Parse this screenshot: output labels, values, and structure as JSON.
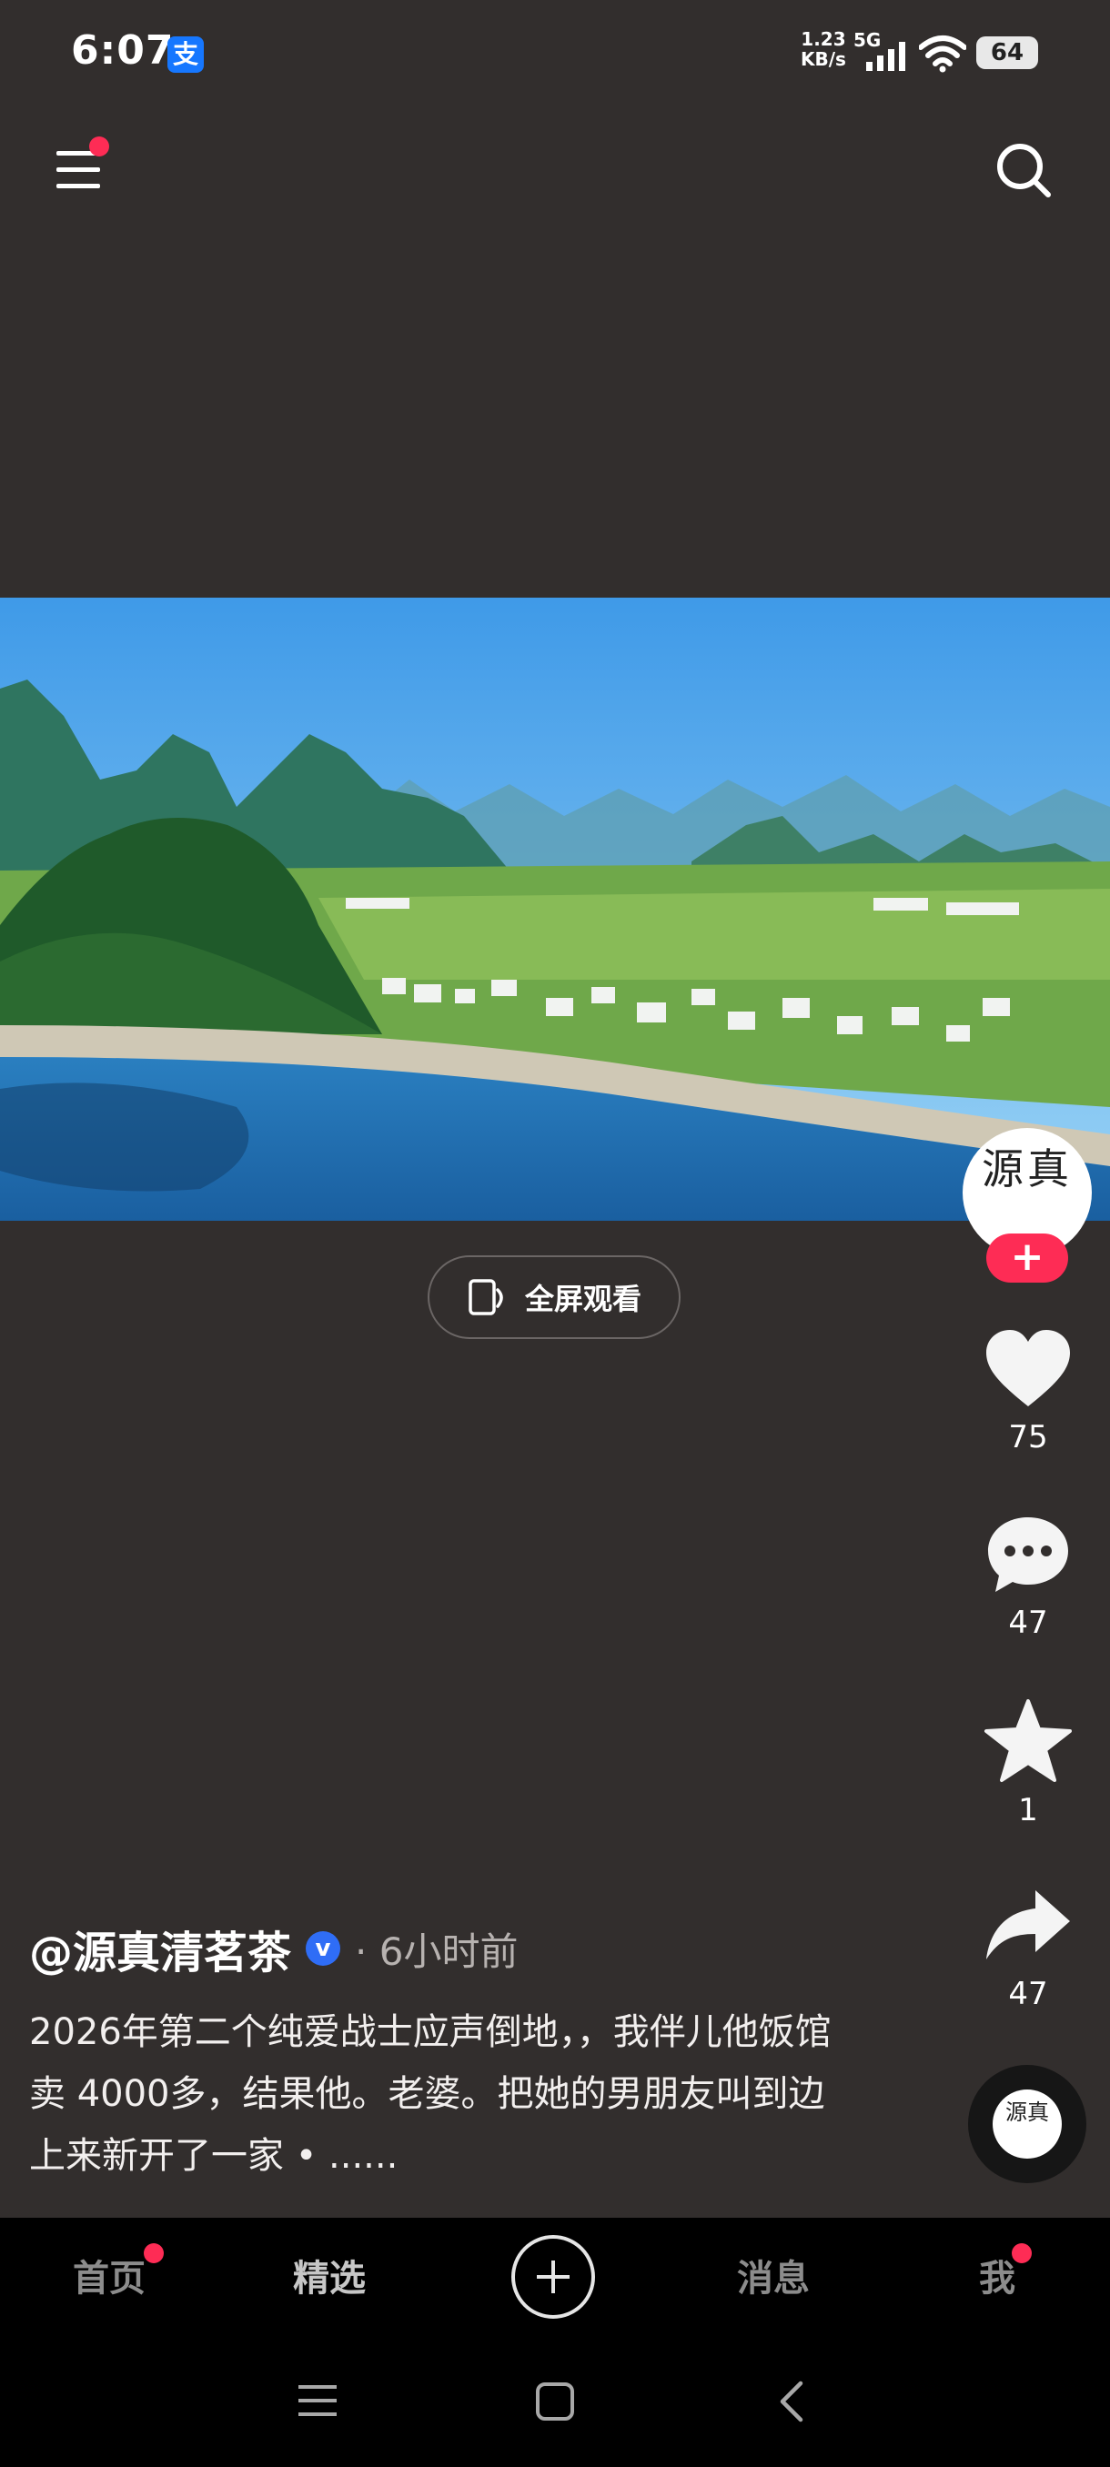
{
  "status_bar": {
    "time": "6:07",
    "alipay_icon_text": "支",
    "net_speed_value": "1.23",
    "net_speed_unit": "KB/s",
    "network_type": "5G",
    "battery_level": "64"
  },
  "video": {
    "fullscreen_label": "全屏观看"
  },
  "author": {
    "avatar_text": "源真",
    "name": "@源真清茗茶",
    "verified_mark": "v",
    "post_time": "· 6小时前"
  },
  "caption": "2026年第二个纯爱战士应声倒地，，我伴儿他饭馆卖 4000多，结果他。老婆。把她的男朋友叫到边上来新开了一家 • ......",
  "actions": {
    "follow_symbol": "+",
    "likes": "75",
    "comments": "47",
    "favorites": "1",
    "shares": "47"
  },
  "nav": {
    "home": "首页",
    "featured": "精选",
    "messages": "消息",
    "me": "我"
  },
  "colors": {
    "background": "#322e2d",
    "accent": "#fe2c55",
    "verified": "#2f6df6"
  }
}
